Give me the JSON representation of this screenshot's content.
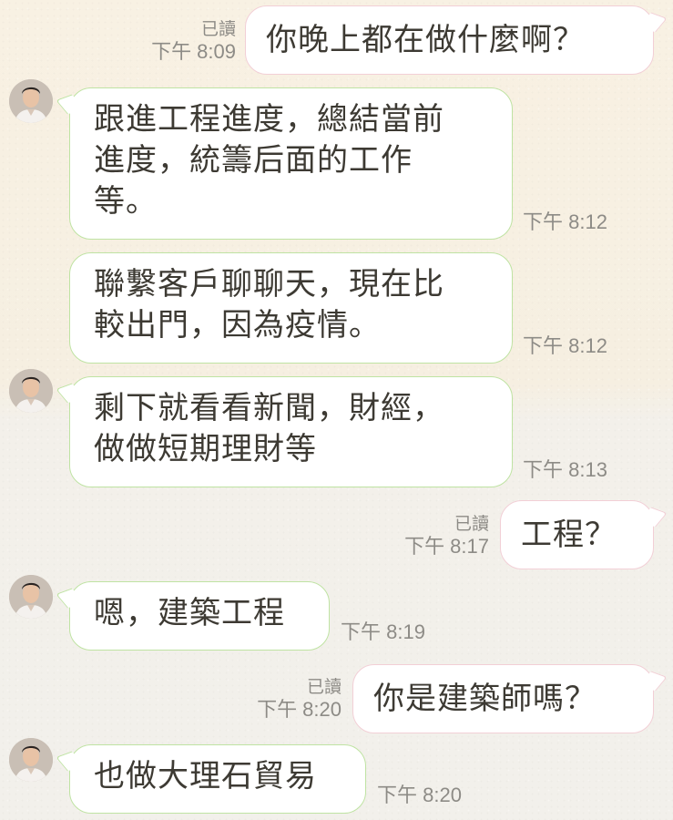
{
  "colors": {
    "incoming_border": "#bfe3a3",
    "outgoing_border": "#f2cfd6",
    "bubble_bg": "#ffffff",
    "text": "#3d3a33",
    "meta": "#8d8b86"
  },
  "messages": [
    {
      "direction": "out",
      "text": "你晚上都在做什麼啊？",
      "read": "已讀",
      "time": "下午 8:09"
    },
    {
      "direction": "in",
      "avatar": "contact-avatar",
      "text": "跟進工程進度，總結當前\n進度，統籌后面的工作\n等。",
      "time": "下午 8:12"
    },
    {
      "direction": "in",
      "text": "聯繫客戶聊聊天，現在比\n較出門，因為疫情。",
      "time": "下午 8:12"
    },
    {
      "direction": "in",
      "avatar": "contact-avatar",
      "text": "剩下就看看新聞，財經，\n做做短期理財等",
      "time": "下午 8:13"
    },
    {
      "direction": "out",
      "text": "工程？",
      "read": "已讀",
      "time": "下午 8:17"
    },
    {
      "direction": "in",
      "avatar": "contact-avatar",
      "text": "嗯，建築工程",
      "time": "下午 8:19"
    },
    {
      "direction": "out",
      "text": "你是建築師嗎？",
      "read": "已讀",
      "time": "下午 8:20"
    },
    {
      "direction": "in",
      "avatar": "contact-avatar",
      "text": "也做大理石貿易",
      "time": "下午 8:20"
    }
  ]
}
